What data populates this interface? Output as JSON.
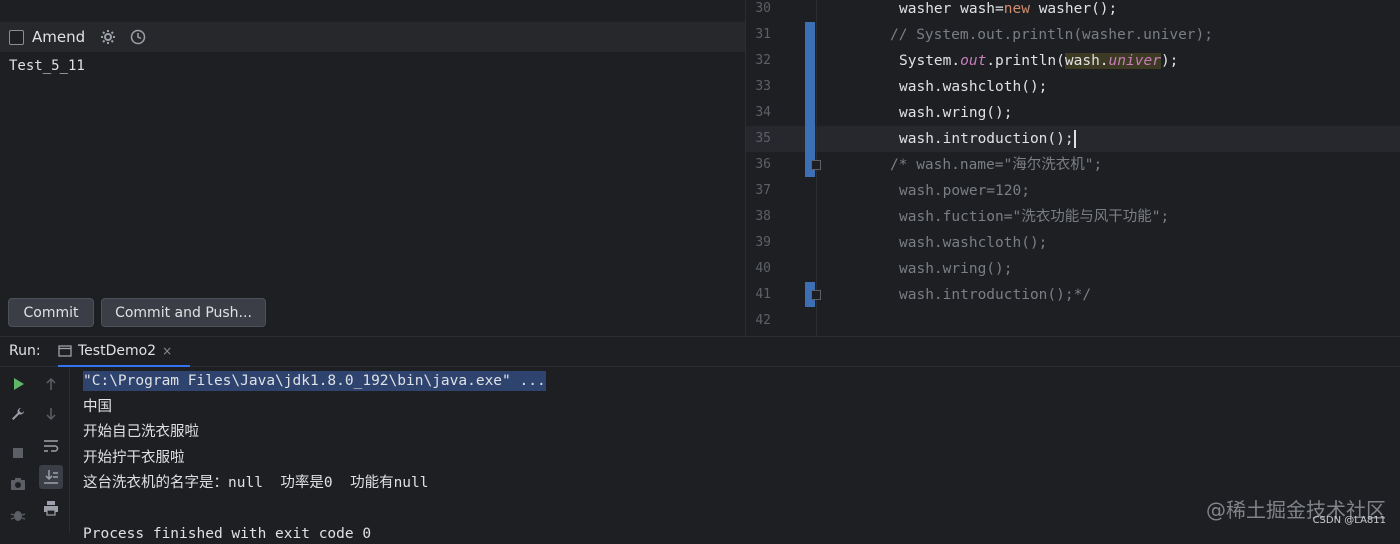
{
  "commit": {
    "amend_label": "Amend",
    "message": "Test_5_11",
    "commit_button": "Commit",
    "commit_push_button": "Commit and Push..."
  },
  "editor": {
    "lines": [
      {
        "num": "30",
        "tokens": [
          {
            "t": "washer wash=",
            "c": "#dfe1e5"
          },
          {
            "t": "new",
            "c": "#cf8e6d"
          },
          {
            "t": " washer();",
            "c": "#dfe1e5"
          }
        ],
        "indent": "   "
      },
      {
        "num": "31",
        "tokens": [
          {
            "t": "// System.out.println(washer.univer);",
            "c": "#7a7e85"
          }
        ],
        "indent": "  "
      },
      {
        "num": "32",
        "tokens": [
          {
            "t": "System.",
            "c": "#dfe1e5"
          },
          {
            "t": "out",
            "c": "#c77dbb",
            "i": true
          },
          {
            "t": ".println(",
            "c": "#dfe1e5"
          },
          {
            "t": "wash.",
            "c": "#dfe1e5",
            "bg": "#3d3a24"
          },
          {
            "t": "univer",
            "c": "#c77dbb",
            "i": true,
            "bg": "#3d3a24"
          },
          {
            "t": ");",
            "c": "#dfe1e5"
          }
        ],
        "indent": "   "
      },
      {
        "num": "33",
        "tokens": [
          {
            "t": "wash.washcloth();",
            "c": "#dfe1e5"
          }
        ],
        "indent": "   "
      },
      {
        "num": "34",
        "tokens": [
          {
            "t": "wash.wring();",
            "c": "#dfe1e5"
          }
        ],
        "indent": "   "
      },
      {
        "num": "35",
        "tokens": [
          {
            "t": "wash.introduction();",
            "c": "#dfe1e5"
          }
        ],
        "indent": "   ",
        "current": true
      },
      {
        "num": "36",
        "tokens": [
          {
            "t": "/* wash.name=\"海尔洗衣机\";",
            "c": "#7a7e85"
          }
        ],
        "indent": "  "
      },
      {
        "num": "37",
        "tokens": [
          {
            "t": "wash.power=120;",
            "c": "#7a7e85"
          }
        ],
        "indent": "   "
      },
      {
        "num": "38",
        "tokens": [
          {
            "t": "wash.fuction=\"洗衣功能与风干功能\";",
            "c": "#7a7e85"
          }
        ],
        "indent": "   "
      },
      {
        "num": "39",
        "tokens": [
          {
            "t": "wash.washcloth();",
            "c": "#7a7e85"
          }
        ],
        "indent": "   "
      },
      {
        "num": "40",
        "tokens": [
          {
            "t": "wash.wring();",
            "c": "#7a7e85"
          }
        ],
        "indent": "   "
      },
      {
        "num": "41",
        "tokens": [
          {
            "t": "wash.introduction();*/",
            "c": "#7a7e85"
          }
        ],
        "indent": "   "
      },
      {
        "num": "42",
        "tokens": [],
        "indent": ""
      }
    ]
  },
  "run": {
    "label": "Run:",
    "tab_label": "TestDemo2",
    "tab_close": "×"
  },
  "console": {
    "lines": [
      "\"C:\\Program Files\\Java\\jdk1.8.0_192\\bin\\java.exe\" ...",
      "中国",
      "开始自己洗衣服啦",
      "开始拧干衣服啦",
      "这台洗衣机的名字是：null  功率是0  功能有null",
      "",
      "Process finished with exit code 0"
    ],
    "highlight_color": "#2e436e"
  },
  "watermark": {
    "main": "@稀土掘金技术社区",
    "sub": "CSDN @LA811"
  },
  "colors": {
    "accent": "#3574f0",
    "change_bar": "#3d6fb4",
    "run_green": "#5fb865"
  }
}
